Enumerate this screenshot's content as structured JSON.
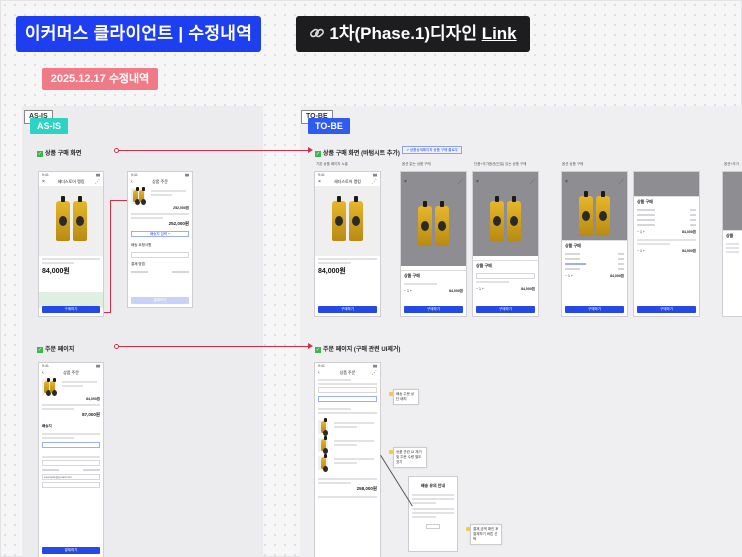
{
  "header": {
    "title": "이커머스 클라이언트 | 수정내역",
    "link_prefix": "1차(Phase.1)디자인 ",
    "link_text": "Link",
    "link_icon": "link-icon",
    "date_badge": "2025.12.17 수정내역"
  },
  "colors": {
    "title_bg": "#1e3ff0",
    "link_bg": "#1d1d1f",
    "date_bg": "#f07b86",
    "asis_tag": "#2bd3c2",
    "tobe_tag": "#2f5bf0",
    "arrow": "#d32f4a",
    "cta": "#2548e6"
  },
  "asis": {
    "tag_outline": "AS-IS",
    "tag": "AS-IS",
    "section1": "상품 구매 화면",
    "section2": "주문 페이지",
    "phone1": {
      "time": "9:41",
      "nav_title": "헤더스토어 랭킹",
      "price": "84,000원",
      "cta": "구매하기"
    },
    "phone2": {
      "nav_title": "상품 주문",
      "item_price": "252,000원",
      "total": "252,000원",
      "add_item": "배송지 입력 +",
      "delivery": "배송 요청사항",
      "payment": "결제 방법",
      "cta": "결제하기"
    },
    "phone3": {
      "nav_title": "상품 주문",
      "item_price": "84,000원",
      "total": "87,000원",
      "address": "배송지",
      "cta": "결제하기",
      "email": "example@gmail.com"
    }
  },
  "tobe": {
    "tag_outline": "TO-BE",
    "tag": "TO-BE",
    "section1": "상품 구매 화면 (바텀시트 추가)",
    "section2": "주문 페이지 (구매 관련 UI제거)",
    "link_chip": "↗ 상품상세페이지 상품 구매 플로우",
    "screens": [
      {
        "note": "기본 상품 페이지 노출",
        "price": "84,000원",
        "cta": "구매하기"
      },
      {
        "note": "옵션 없는 상품 구매",
        "sheet_title": "상품 구매",
        "price": "84,000원",
        "cta": "구매하기"
      },
      {
        "note": "단품+추가옵션(단일) 있는 상품 구매",
        "sheet_title": "상품 구매",
        "price": "84,000원",
        "cta": "구매하기"
      },
      {
        "note": "옵션 상품 구매",
        "sheet_title": "상품 구매",
        "price": "84,000원",
        "cta": "구매하기"
      },
      {
        "note": "",
        "sheet_title": "상품 구매",
        "price": "84,000원",
        "cta": "구매하기"
      },
      {
        "note": "옵션+추가",
        "sheet_title": "상품",
        "price": "",
        "cta": ""
      }
    ],
    "order": {
      "nav_title": "상품 주문",
      "total": "258,000원",
      "cta": "결제하기",
      "callout1": "배송 주문 상단 배치",
      "callout2": "상품 관련 UI 제거 및 주문 수량 별도 표기",
      "callout3": "결제 금액 확인 후 결제하기 버튼 선택",
      "modal_title": "배송 유의 안내"
    }
  }
}
